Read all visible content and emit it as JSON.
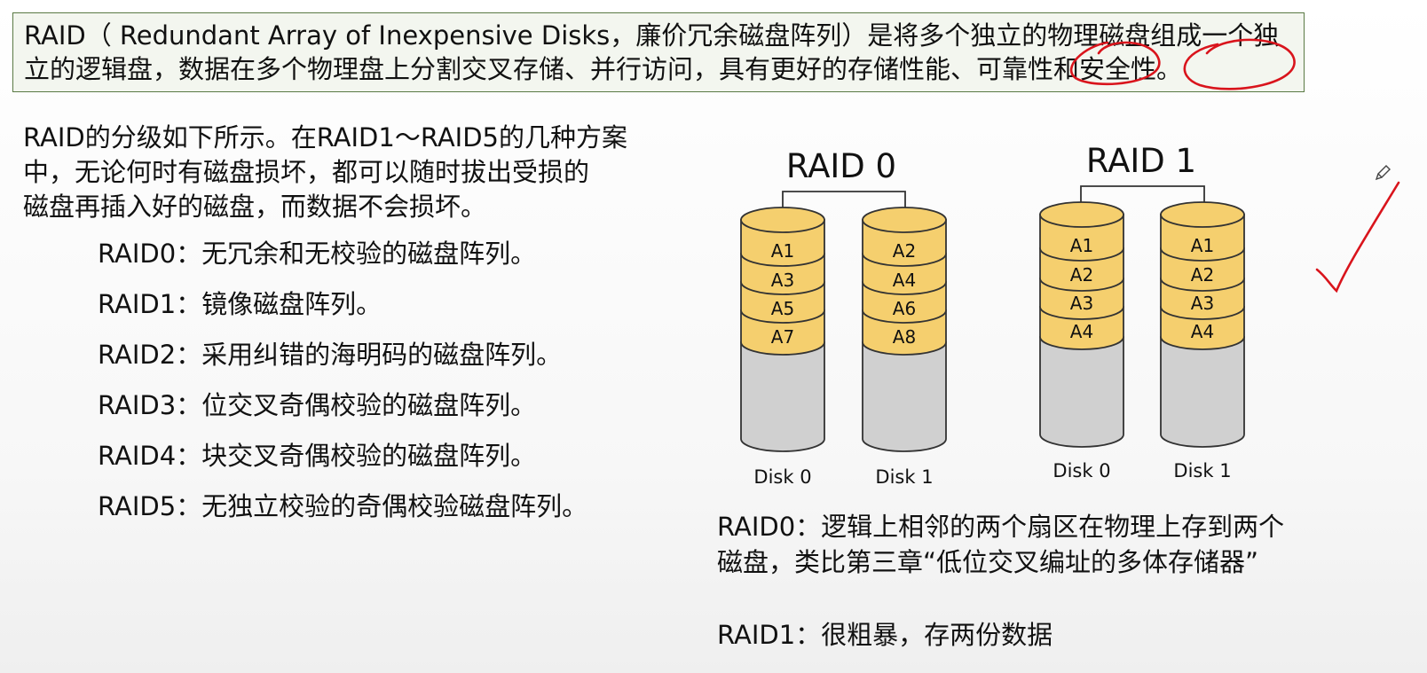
{
  "header_box": {
    "line1": "RAID（ Redundant Array of Inexpensive Disks，廉价冗余磁盘阵列）是将多个独立的物理磁盘组成一个独",
    "line2": "立的逻辑盘，数据在多个物理盘上分割交叉存储、并行访问，具有更好的存储性能、可靠性和安全性。"
  },
  "intro": {
    "line1": "RAID的分级如下所示。在RAID1～RAID5的几种方案",
    "line2": "中，无论何时有磁盘损坏，都可以随时拔出受损的",
    "line3": "磁盘再插入好的磁盘，而数据不会损坏。"
  },
  "levels": [
    "RAID0：无冗余和无校验的磁盘阵列。",
    "RAID1：镜像磁盘阵列。",
    "RAID2：采用纠错的海明码的磁盘阵列。",
    "RAID3：位交叉奇偶校验的磁盘阵列。",
    "RAID4：块交叉奇偶校验的磁盘阵列。",
    "RAID5：无独立校验的奇偶校验磁盘阵列。"
  ],
  "diagram": {
    "raid0": {
      "title": "RAID 0",
      "disk0": {
        "label": "Disk 0",
        "blocks": [
          "A1",
          "A3",
          "A5",
          "A7"
        ]
      },
      "disk1": {
        "label": "Disk 1",
        "blocks": [
          "A2",
          "A4",
          "A6",
          "A8"
        ]
      }
    },
    "raid1": {
      "title": "RAID 1",
      "disk0": {
        "label": "Disk 0",
        "blocks": [
          "A1",
          "A2",
          "A3",
          "A4"
        ]
      },
      "disk1": {
        "label": "Disk 1",
        "blocks": [
          "A1",
          "A2",
          "A3",
          "A4"
        ]
      }
    },
    "colors": {
      "block_fill": "#f5cf6e",
      "disk_body": "#d0d0d0",
      "outline": "#333333",
      "annotation_red": "#d9141c"
    }
  },
  "notes": {
    "raid0_line1": "RAID0：逻辑上相邻的两个扇区在物理上存到两个",
    "raid0_line2": "磁盘，类比第三章“低位交叉编址的多体存储器”",
    "raid1_line1": "RAID1：很粗暴，存两份数据"
  }
}
